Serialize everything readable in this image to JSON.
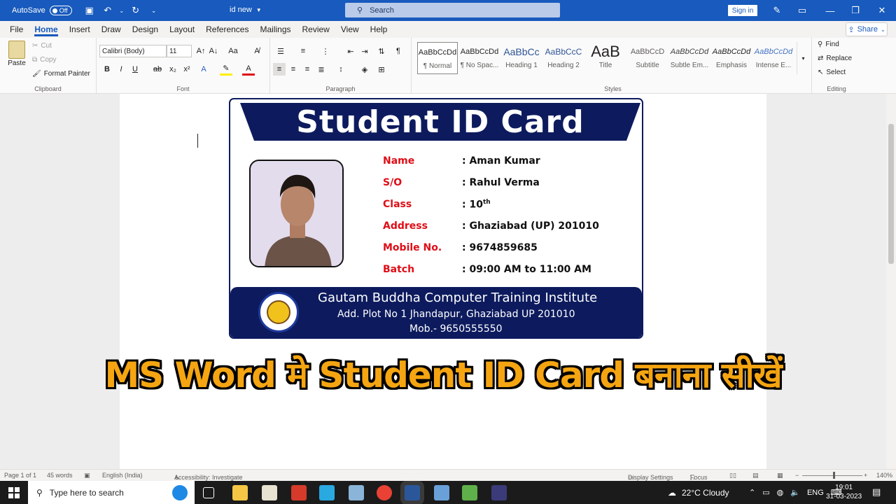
{
  "titlebar": {
    "autosave_label": "AutoSave",
    "autosave_state": "Off",
    "doc_name": "id new",
    "search_placeholder": "Search",
    "signin_label": "Sign in"
  },
  "menu": {
    "tabs": [
      "File",
      "Home",
      "Insert",
      "Draw",
      "Design",
      "Layout",
      "References",
      "Mailings",
      "Review",
      "View",
      "Help"
    ],
    "active": "Home",
    "share_label": "Share"
  },
  "ribbon": {
    "clipboard": {
      "paste": "Paste",
      "cut": "Cut",
      "copy": "Copy",
      "format_painter": "Format Painter",
      "group_label": "Clipboard"
    },
    "font": {
      "font_name": "Calibri (Body)",
      "font_size": "11",
      "group_label": "Font"
    },
    "paragraph": {
      "group_label": "Paragraph"
    },
    "styles": {
      "group_label": "Styles",
      "items": [
        {
          "sample": "AaBbCcDd",
          "name": "¶ Normal"
        },
        {
          "sample": "AaBbCcDd",
          "name": "¶ No Spac..."
        },
        {
          "sample": "AaBbCc",
          "name": "Heading 1"
        },
        {
          "sample": "AaBbCcC",
          "name": "Heading 2"
        },
        {
          "sample": "AaB",
          "name": "Title"
        },
        {
          "sample": "AaBbCcD",
          "name": "Subtitle"
        },
        {
          "sample": "AaBbCcDd",
          "name": "Subtle Em..."
        },
        {
          "sample": "AaBbCcDd",
          "name": "Emphasis"
        },
        {
          "sample": "AaBbCcDd",
          "name": "Intense E..."
        }
      ]
    },
    "editing": {
      "find": "Find",
      "replace": "Replace",
      "select": "Select",
      "group_label": "Editing"
    }
  },
  "card": {
    "title": "Student ID Card",
    "fields": [
      {
        "label": "Name",
        "value": ": Aman Kumar"
      },
      {
        "label": "S/O",
        "value": ": Rahul Verma"
      },
      {
        "label": "Class",
        "value": ": 10",
        "sup": "th"
      },
      {
        "label": "Address",
        "value": ": Ghaziabad (UP) 201010"
      },
      {
        "label": "Mobile No.",
        "value": ": 9674859685"
      },
      {
        "label": "Batch",
        "value": ": 09:00 AM to 11:00 AM"
      }
    ],
    "institute": "Gautam Buddha Computer Training Institute",
    "address": "Add. Plot No 1 Jhandapur, Ghaziabad UP 201010",
    "mobile": "Mob.- 9650555550"
  },
  "overlay_title": "MS Word मे Student ID Card बनाना सीखें",
  "status": {
    "page": "Page 1 of 1",
    "words": "45 words",
    "language": "English (India)",
    "accessibility": "Accessibility: Investigate",
    "display_settings": "Display Settings",
    "focus": "Focus",
    "zoom": "140%"
  },
  "taskbar": {
    "search_placeholder": "Type here to search",
    "weather": "22°C  Cloudy",
    "lang": "ENG",
    "time": "19:01",
    "date": "31-03-2023"
  },
  "colors": {
    "word_blue": "#185abd",
    "card_navy": "#0d1b5e",
    "label_red": "#e00d16",
    "overlay_orange": "#f5a511"
  }
}
